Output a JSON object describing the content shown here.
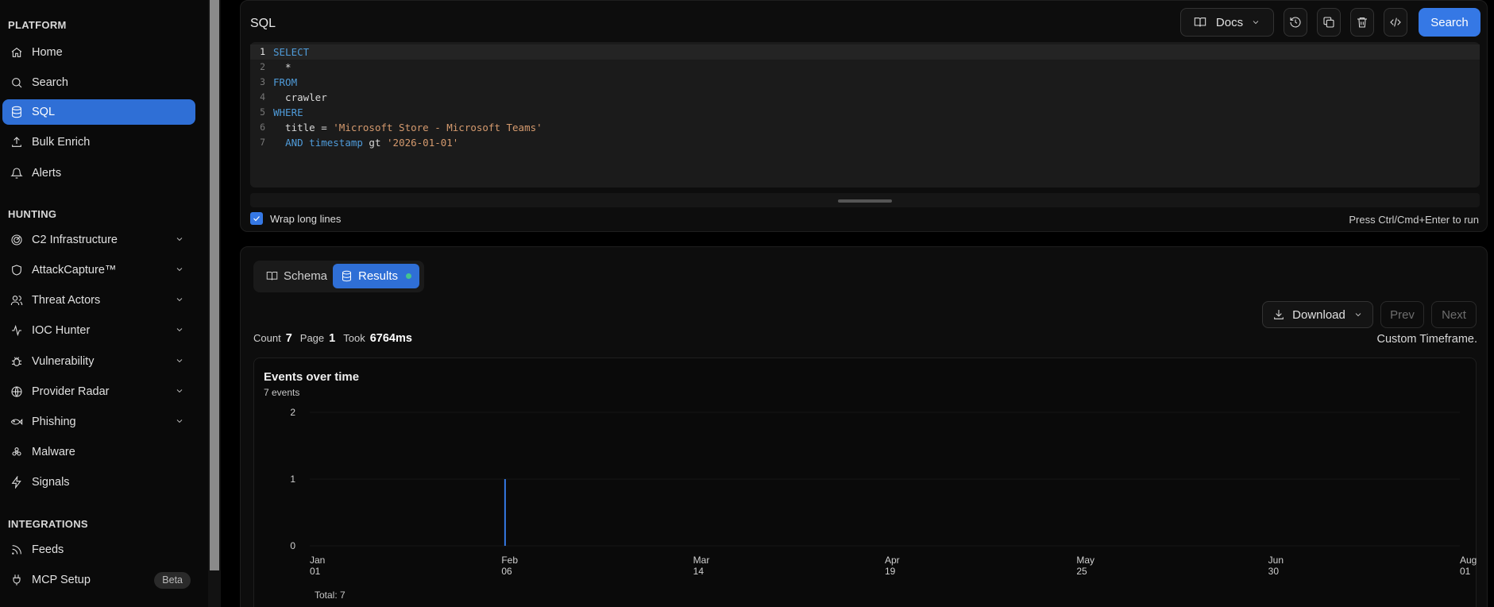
{
  "sidebar": {
    "sections": [
      {
        "title": "PLATFORM",
        "items": [
          {
            "label": "Home",
            "icon": "home-icon"
          },
          {
            "label": "Search",
            "icon": "search-icon"
          },
          {
            "label": "SQL",
            "icon": "database-icon",
            "active": true
          },
          {
            "label": "Bulk Enrich",
            "icon": "upload-icon"
          },
          {
            "label": "Alerts",
            "icon": "bell-icon"
          }
        ]
      },
      {
        "title": "HUNTING",
        "items": [
          {
            "label": "C2 Infrastructure",
            "icon": "radar-icon",
            "expandable": true
          },
          {
            "label": "AttackCapture™",
            "icon": "shield-icon",
            "expandable": true
          },
          {
            "label": "Threat Actors",
            "icon": "users-icon",
            "expandable": true
          },
          {
            "label": "IOC Hunter",
            "icon": "activity-icon",
            "expandable": true
          },
          {
            "label": "Vulnerability",
            "icon": "bug-icon",
            "expandable": true
          },
          {
            "label": "Provider Radar",
            "icon": "globe-icon",
            "expandable": true
          },
          {
            "label": "Phishing",
            "icon": "fish-icon",
            "expandable": true
          },
          {
            "label": "Malware",
            "icon": "biohazard-icon"
          },
          {
            "label": "Signals",
            "icon": "zap-icon"
          }
        ]
      },
      {
        "title": "INTEGRATIONS",
        "items": [
          {
            "label": "Feeds",
            "icon": "rss-icon"
          },
          {
            "label": "MCP Setup",
            "icon": "plug-icon",
            "badge": "Beta"
          }
        ]
      }
    ]
  },
  "sql": {
    "title": "SQL",
    "docs_label": "Docs",
    "search_label": "Search",
    "lines": [
      {
        "n": "1",
        "parts": [
          [
            "kw",
            "SELECT"
          ]
        ]
      },
      {
        "n": "2",
        "parts": [
          [
            "pl",
            "  *"
          ]
        ]
      },
      {
        "n": "3",
        "parts": [
          [
            "kw",
            "FROM"
          ]
        ]
      },
      {
        "n": "4",
        "parts": [
          [
            "pl",
            "  crawler"
          ]
        ]
      },
      {
        "n": "5",
        "parts": [
          [
            "kw",
            "WHERE"
          ]
        ]
      },
      {
        "n": "6",
        "parts": [
          [
            "pl",
            "  title = "
          ],
          [
            "str",
            "'Microsoft Store - Microsoft Teams'"
          ]
        ]
      },
      {
        "n": "7",
        "parts": [
          [
            "pl",
            "  "
          ],
          [
            "kw",
            "AND timestamp"
          ],
          [
            "pl",
            " gt "
          ],
          [
            "str",
            "'2026-01-01'"
          ]
        ]
      }
    ],
    "wrap_label": "Wrap long lines",
    "wrap_checked": true,
    "hint": "Press Ctrl/Cmd+Enter to run"
  },
  "results": {
    "tabs": {
      "schema": "Schema",
      "results": "Results"
    },
    "download_label": "Download",
    "prev_label": "Prev",
    "next_label": "Next",
    "stats": {
      "count_label": "Count",
      "count": "7",
      "page_label": "Page",
      "page": "1",
      "took_label": "Took",
      "took": "6764ms"
    },
    "timeframe": "Custom Timeframe."
  },
  "chart_data": {
    "type": "bar",
    "title": "Events over time",
    "subtitle": "7 events",
    "ylim": [
      0,
      2
    ],
    "y_ticks": [
      "0",
      "1",
      "2"
    ],
    "x_ticks": [
      {
        "month": "Jan",
        "day": "01"
      },
      {
        "month": "Feb",
        "day": "06"
      },
      {
        "month": "Mar",
        "day": "14"
      },
      {
        "month": "Apr",
        "day": "19"
      },
      {
        "month": "May",
        "day": "25"
      },
      {
        "month": "Jun",
        "day": "30"
      },
      {
        "month": "Aug",
        "day": "01"
      }
    ],
    "x_range_days": [
      0,
      212
    ],
    "bars": [
      {
        "day": 36,
        "value": 1
      }
    ],
    "total_label": "Total: 7",
    "bar_color": "#3578e5"
  }
}
